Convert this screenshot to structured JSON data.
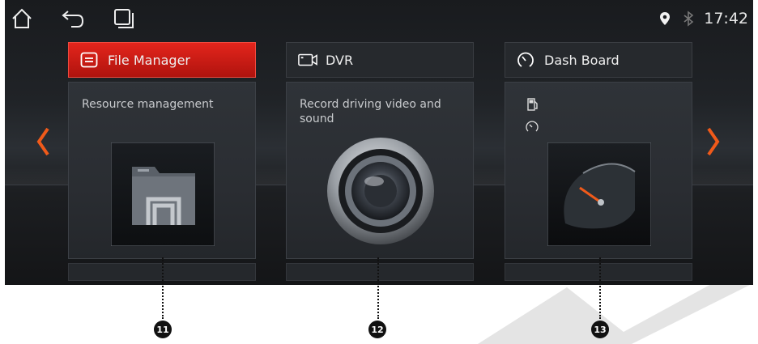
{
  "status_bar": {
    "time": "17:42"
  },
  "cards": [
    {
      "title": "File Manager",
      "description": "Resource management"
    },
    {
      "title": "DVR",
      "description": "Record driving video and sound"
    },
    {
      "title": "Dash Board",
      "description": ""
    }
  ],
  "callouts": [
    "11",
    "12",
    "13"
  ],
  "colors": {
    "accent": "#e3251c",
    "arrow": "#f05a1a"
  }
}
